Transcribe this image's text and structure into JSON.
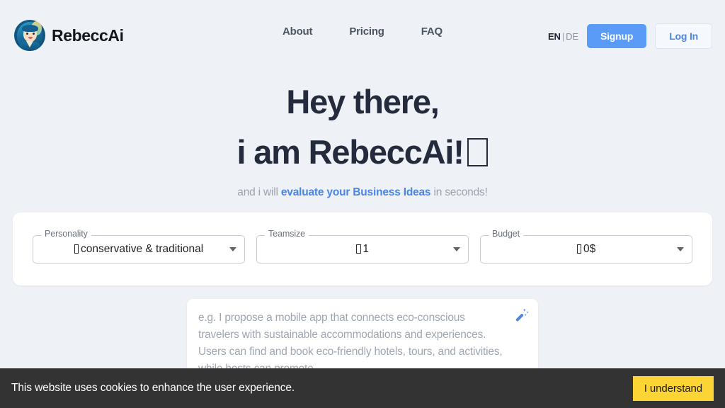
{
  "header": {
    "brand_name": "RebeccAi",
    "logo_icon": "rebeccai-avatar-icon",
    "nav": [
      {
        "label": "About"
      },
      {
        "label": "Pricing"
      },
      {
        "label": "FAQ"
      }
    ],
    "lang": {
      "active": "EN",
      "separator": "|",
      "inactive": "DE"
    },
    "signup_label": "Signup",
    "login_label": "Log In"
  },
  "hero": {
    "line1": "Hey there,",
    "line2": "i am RebeccAi!",
    "line2_trailing_glyph": "missing-glyph-box",
    "sub_before": "and i will ",
    "sub_highlight": "evaluate your Business Ideas",
    "sub_after": " in seconds!"
  },
  "form": {
    "fields": [
      {
        "label": "Personality",
        "value": "conservative & traditional",
        "leading_glyph": "missing-glyph-box",
        "caret_icon": "chevron-down-icon"
      },
      {
        "label": "Teamsize",
        "value": "1",
        "leading_glyph": "missing-glyph-box",
        "caret_icon": "chevron-down-icon"
      },
      {
        "label": "Budget",
        "value": "0$",
        "leading_glyph": "missing-glyph-box",
        "caret_icon": "chevron-down-icon"
      }
    ]
  },
  "prompt": {
    "placeholder": "e.g. I propose a mobile app that connects eco-conscious travelers with sustainable accommodations and experiences. Users can find and book eco-friendly hotels, tours, and activities, while hosts can promote",
    "wand_icon": "magic-wand-icon"
  },
  "cookie": {
    "message": "This website uses cookies to enhance the user experience.",
    "accept_label": "I understand"
  },
  "colors": {
    "page_background": "#eef1f6",
    "heading": "#232b3d",
    "accent_blue": "#4a85e8",
    "signup_blue": "#5b9bf8",
    "muted_text": "#9aa3b1",
    "cookie_bar": "#333333",
    "cookie_button": "#fcd535"
  }
}
